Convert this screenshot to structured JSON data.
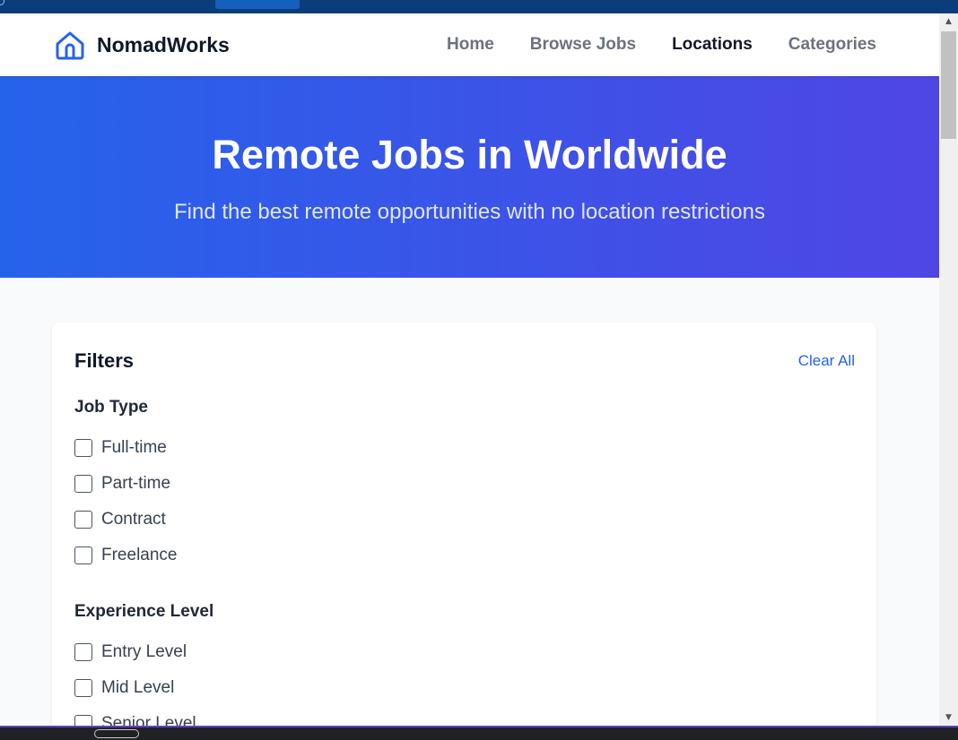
{
  "brand": {
    "name": "NomadWorks",
    "icon": "home-icon",
    "accent": "#2563eb"
  },
  "nav": {
    "links": [
      {
        "label": "Home",
        "active": false
      },
      {
        "label": "Browse Jobs",
        "active": false
      },
      {
        "label": "Locations",
        "active": true
      },
      {
        "label": "Categories",
        "active": false
      }
    ]
  },
  "hero": {
    "title": "Remote Jobs in Worldwide",
    "subtitle": "Find the best remote opportunities with no location restrictions",
    "gradient": [
      "#2563eb",
      "#4f46e5"
    ]
  },
  "filters": {
    "title": "Filters",
    "clear_label": "Clear All",
    "groups": [
      {
        "title": "Job Type",
        "options": [
          "Full-time",
          "Part-time",
          "Contract",
          "Freelance"
        ]
      },
      {
        "title": "Experience Level",
        "options": [
          "Entry Level",
          "Mid Level",
          "Senior Level"
        ]
      }
    ]
  }
}
